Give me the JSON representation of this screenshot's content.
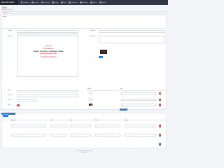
{
  "app": {
    "brand": "OpenCart Admin",
    "nav": [
      "Dashboard",
      "Catalog",
      "Extensions",
      "Design",
      "Sales",
      "Customers",
      "Marketing",
      "System",
      "Reports"
    ]
  },
  "page": {
    "title": "Ürün",
    "breadcrumb": "Ana Sayfa / Ürünler",
    "tab": "Genel",
    "alert": "Uyarı"
  },
  "form": {
    "name_label": "Ürün Adı",
    "name_value": "Lacivert Kadın Babet Ayakkabı - Rahat Kalıp",
    "desc_label": "Açıklama",
    "editor": {
      "lines": [
        {
          "text": "3 AL 2 ÖDE",
          "style": "red"
        },
        {
          "text": "% 100 HAKİKİ DERİ",
          "style": "red"
        },
        {
          "text": "KUNDURA · OZEL ÜRETİM · TUM BEDENLER · NUMARA",
          "style": "dark"
        },
        {
          "text": "GÜNLÜK KULLANIM İÇİN İDEAL",
          "style": "red"
        },
        {
          "text": "%100 MÜŞTERİ MEMNUNİYETİ",
          "style": "red"
        }
      ]
    },
    "meta_title_label": "Meta Başlık",
    "meta_title_value": "Ürün",
    "keywords_label": "Anahtar Kel.",
    "model_label": "Model",
    "model_value": "LAD",
    "category_label": "Kategori",
    "category_value": "Ayakkabı",
    "status_label": "Durum",
    "status_value": "Etkin",
    "price_label": "Fiyat",
    "price_value": "0.00"
  },
  "images": {
    "col1": "Resim",
    "col2": "Sıra",
    "add_image": "Resim Ekle"
  },
  "options": {
    "tabs": [
      "Seçenek",
      "Beden"
    ],
    "header_values": [
      "Seçenek",
      "Stok",
      "Fiyat",
      "Puan",
      "Ağırlık"
    ],
    "row1": [
      "Beden",
      "Evet",
      "+",
      "+",
      "+"
    ],
    "row2": [
      "Numara",
      "Evet",
      "+",
      "+",
      "+"
    ]
  },
  "footer": {
    "line1": "OpenCart © 2009-2024 Tüm Hakları Saklıdır.",
    "line2": "Version 3.0.3.8"
  }
}
